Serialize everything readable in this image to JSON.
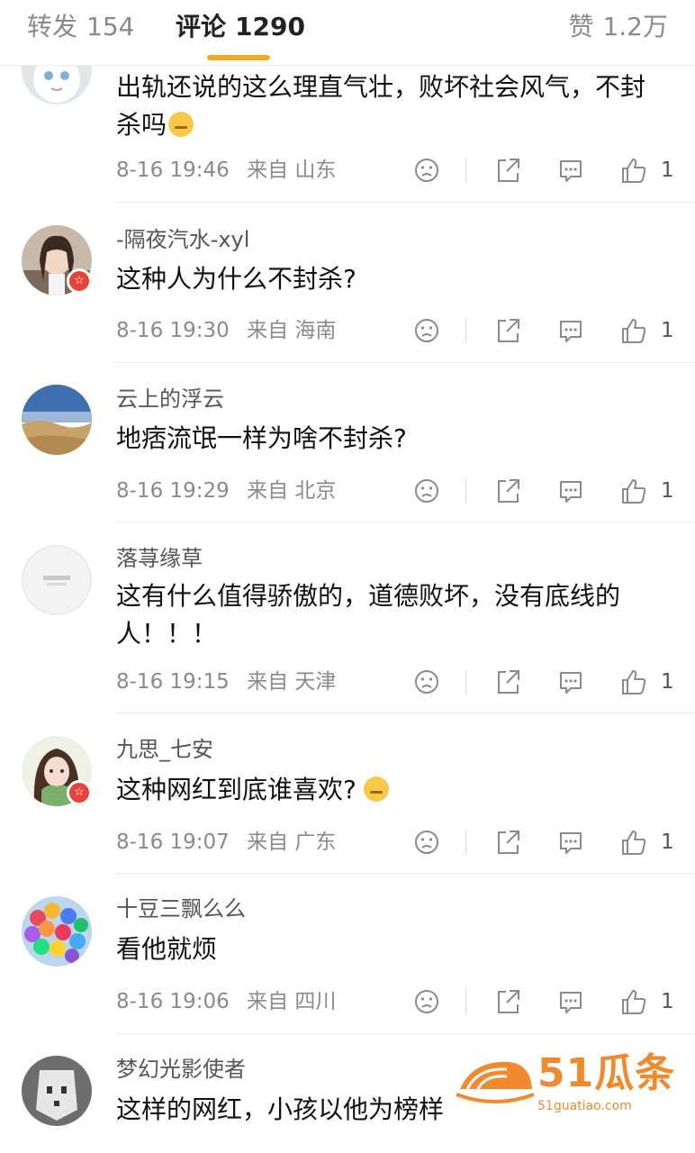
{
  "tabs": {
    "repost_label": "转发",
    "repost_count": "154",
    "comment_label": "评论",
    "comment_count": "1290",
    "like_label": "赞",
    "like_count": "1.2万"
  },
  "comments": [
    {
      "username": "",
      "text": "出轨还说的这么理直气壮，败坏社会风气，不封杀吗",
      "emoji": "sweat-emoji",
      "time": "8-16 19:46",
      "source": "来自",
      "location": "山东",
      "likes": "1"
    },
    {
      "username": "-隔夜汽水-xyl",
      "text": "这种人为什么不封杀?",
      "time": "8-16 19:30",
      "source": "来自",
      "location": "海南",
      "likes": "1",
      "badge": "☆"
    },
    {
      "username": "云上的浮云",
      "text": "地痞流氓一样为啥不封杀?",
      "time": "8-16 19:29",
      "source": "来自",
      "location": "北京",
      "likes": "1"
    },
    {
      "username": "落荨缘草",
      "text": "这有什么值得骄傲的，道德败坏，没有底线的人！！！",
      "time": "8-16 19:15",
      "source": "来自",
      "location": "天津",
      "likes": "1"
    },
    {
      "username": "九思_七安",
      "text": "这种网红到底谁喜欢?",
      "emoji": "thinking-emoji",
      "time": "8-16 19:07",
      "source": "来自",
      "location": "广东",
      "likes": "1",
      "badge": "☆"
    },
    {
      "username": "十豆三飘么么",
      "text": "看他就烦",
      "time": "8-16 19:06",
      "source": "来自",
      "location": "四川",
      "likes": "1"
    },
    {
      "username": "梦幻光影使者",
      "text": "这样的网红，小孩以他为榜样"
    }
  ],
  "watermark": {
    "text": "51瓜条",
    "sub": "51guatiao.com"
  },
  "colors": {
    "accent": "#f5a623",
    "badge": "#e8433b",
    "watermark": "#f08a2c"
  }
}
